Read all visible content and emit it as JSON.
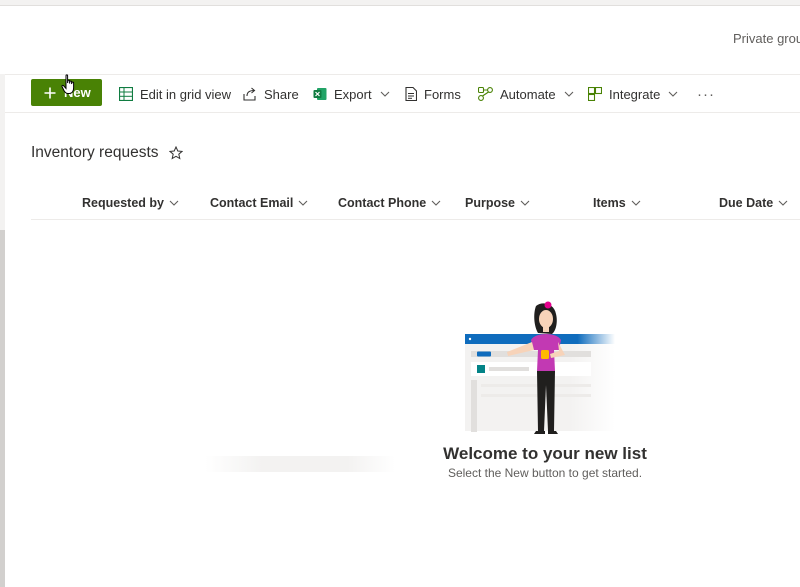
{
  "header": {
    "group_label": "Private group"
  },
  "toolbar": {
    "new_label": "New",
    "edit_grid_label": "Edit in grid view",
    "share_label": "Share",
    "export_label": "Export",
    "forms_label": "Forms",
    "automate_label": "Automate",
    "integrate_label": "Integrate",
    "more_label": "···"
  },
  "list": {
    "title": "Inventory requests"
  },
  "columns": [
    "Requested by",
    "Contact Email",
    "Contact Phone",
    "Purpose",
    "Items",
    "Due Date"
  ],
  "empty_state": {
    "title": "Welcome to your new list",
    "subtitle": "Select the New button to get started."
  },
  "colors": {
    "accent_green": "#498205",
    "excel_green": "#107c41",
    "brand_blue": "#0f6cbd",
    "text": "#323130",
    "subtle_text": "#605e5c"
  },
  "icons": {
    "new": "plus-icon",
    "edit_grid": "grid-icon",
    "share": "share-icon",
    "export": "excel-icon",
    "forms": "forms-icon",
    "automate": "flow-icon",
    "integrate": "integrate-icon",
    "favorite": "star-icon"
  }
}
